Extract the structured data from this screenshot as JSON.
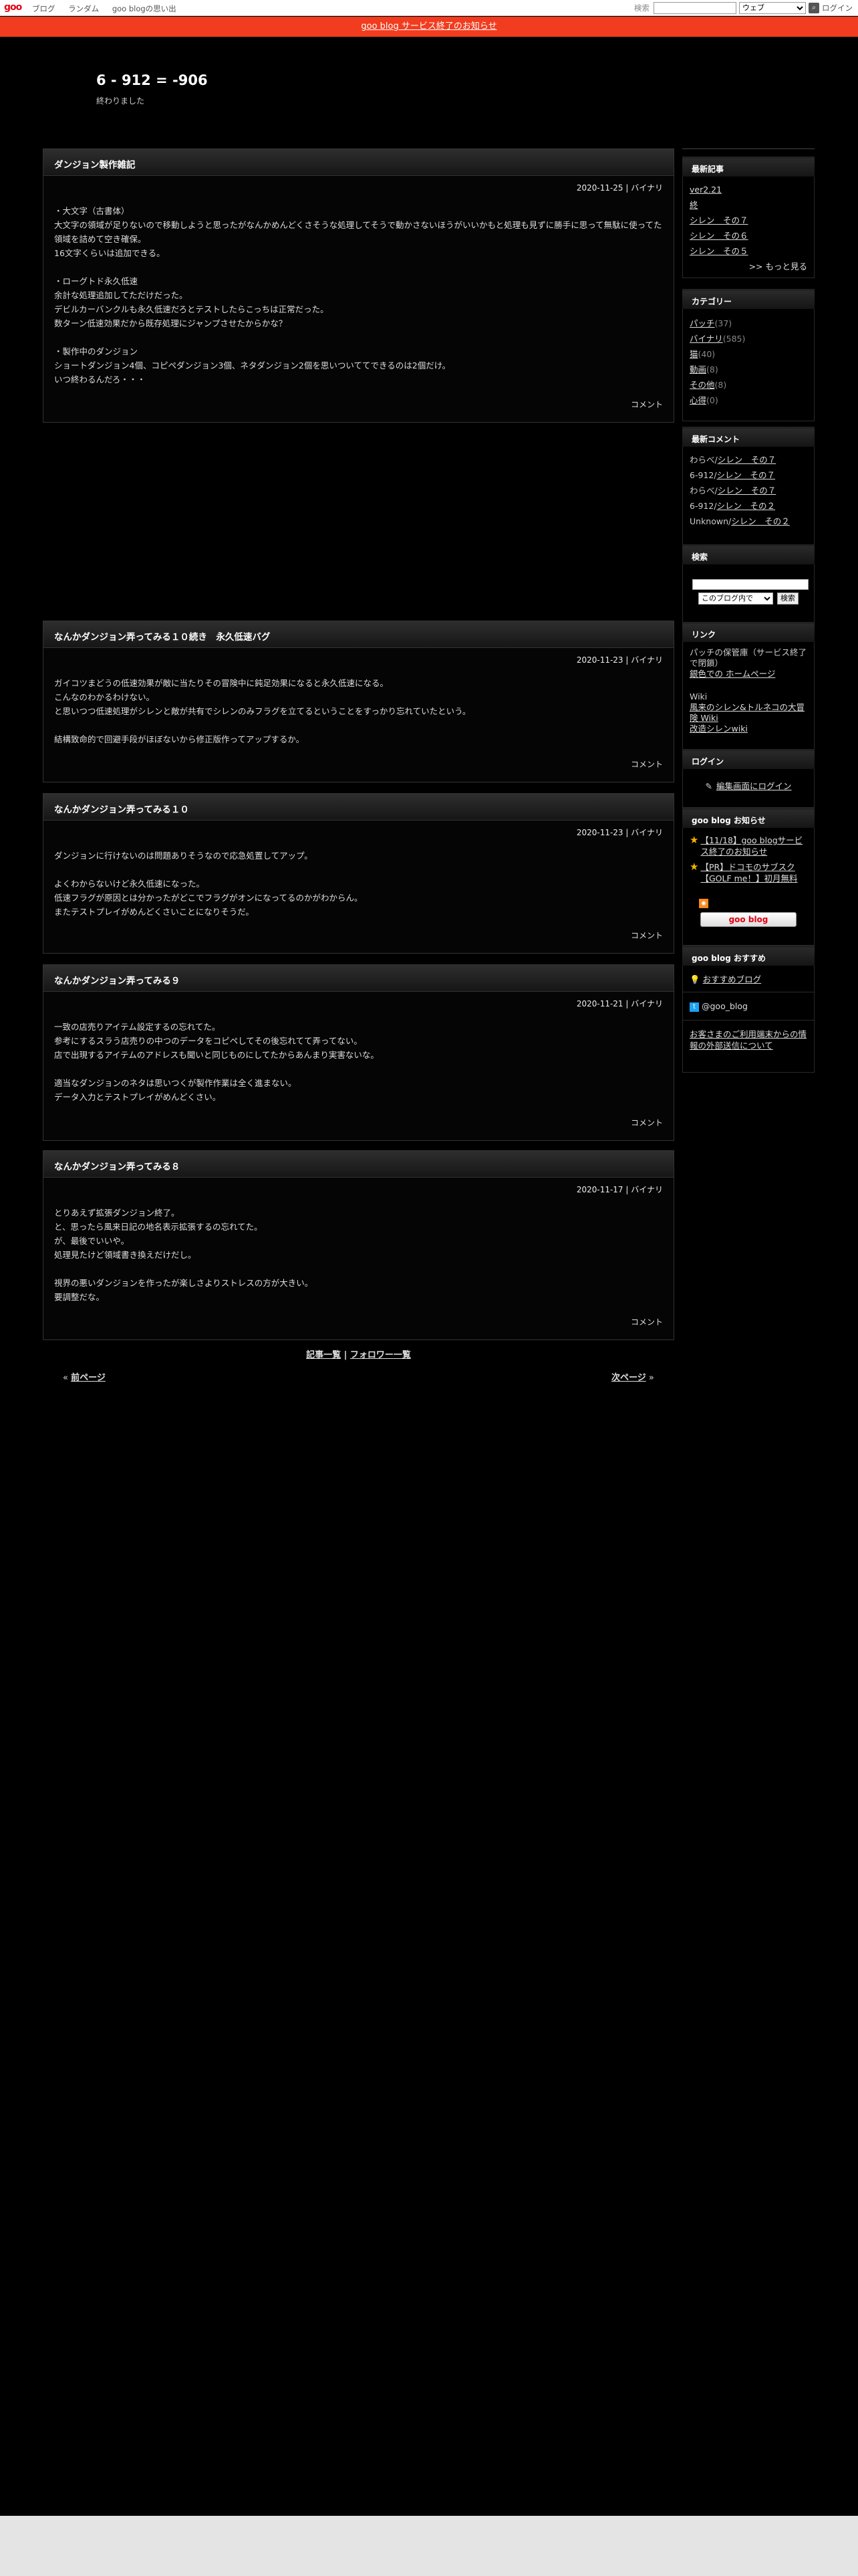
{
  "goo_bar": {
    "logo": "goo",
    "nav": [
      "ブログ",
      "ランダム",
      "goo blogの思い出"
    ],
    "search_label": "検索",
    "search_scope": "ウェブ",
    "login": "ログイン"
  },
  "notice": "goo blog サービス終了のお知らせ",
  "blog": {
    "title": "6 - 912 = -906",
    "description": "終わりました"
  },
  "posts": [
    {
      "title": "ダンジョン製作雑記",
      "meta": "2020-11-25 | バイナリ",
      "body": "・大文字（古書体）\n大文字の領域が足りないので移動しようと思ったがなんかめんどくさそうな処理してそうで動かさないほうがいいかもと処理も見ずに勝手に思って無駄に使ってた領域を詰めて空き確保。\n16文字くらいは追加できる。\n\n・ローグトド永久低速\n余計な処理追加してただけだった。\nデビルカーバンクルも永久低速だろとテストしたらこっちは正常だった。\n数ターン低速効果だから既存処理にジャンプさせたからかな？\n\n・製作中のダンジョン\nショートダンジョン4個、コピペダンジョン3個、ネタダンジョン2個を思いついててできるのは2個だけ。\nいつ終わるんだろ・・・",
      "comment": "コメント"
    },
    {
      "title": "なんかダンジョン弄ってみる１０続き　永久低速バグ",
      "meta": "2020-11-23 | バイナリ",
      "body": "ガイコツまどうの低速効果が敵に当たりその冒険中に鈍足効果になると永久低速になる。\nこんなのわかるわけない。\nと思いつつ低速処理がシレンと敵が共有でシレンのみフラグを立てるということをすっかり忘れていたという。\n\n結構致命的で回避手段がほぼないから修正版作ってアップするか。",
      "comment": "コメント"
    },
    {
      "title": "なんかダンジョン弄ってみる１０",
      "meta": "2020-11-23 | バイナリ",
      "body": "ダンジョンに行けないのは問題ありそうなので応急処置してアップ。\n\nよくわからないけど永久低速になった。\n低速フラグが原因とは分かったがどこでフラグがオンになってるのかがわからん。\nまたテストプレイがめんどくさいことになりそうだ。",
      "comment": "コメント"
    },
    {
      "title": "なんかダンジョン弄ってみる９",
      "meta": "2020-11-21 | バイナリ",
      "body": "一致の店売りアイテム設定するの忘れてた。\n参考にするスラう店売りの中つのデータをコピペしてその後忘れてて弄ってない。\n店で出現するアイテムのアドレスも聞いと同じものにしてたからあんまり実害ないな。\n\n適当なダンジョンのネタは思いつくが製作作業は全く進まない。\nデータ入力とテストプレイがめんどくさい。",
      "comment": "コメント"
    },
    {
      "title": "なんかダンジョン弄ってみる８",
      "meta": "2020-11-17 | バイナリ",
      "body": "とりあえず拡張ダンジョン終了。\nと、思ったら風来日記の地名表示拡張するの忘れてた。\nが、最後でいいや。\n処理見たけど領域書き換えだけだし。\n\n視界の悪いダンジョンを作ったが楽しさよりストレスの方が大きい。\n要調整だな。",
      "comment": "コメント"
    }
  ],
  "post_footer": {
    "list": "記事一覧",
    "sep": "|",
    "followers": "フォロワー一覧"
  },
  "pager": {
    "prev_arrow": "«",
    "prev": "前ページ",
    "next": "次ページ",
    "next_arrow": "»"
  },
  "sidebar": {
    "recent_title": "最新記事",
    "recent": [
      "ver2.21",
      "終",
      "シレン　その７",
      "シレン　その６",
      "シレン　その５"
    ],
    "recent_more": ">> もっと見る",
    "category_title": "カテゴリー",
    "categories": [
      {
        "name": "パッチ",
        "count": "(37)"
      },
      {
        "name": "バイナリ",
        "count": "(585)"
      },
      {
        "name": "猫",
        "count": "(40)"
      },
      {
        "name": "動画",
        "count": "(8)"
      },
      {
        "name": "その他",
        "count": "(8)"
      },
      {
        "name": "心得",
        "count": "(0)"
      }
    ],
    "comments_title": "最新コメント",
    "comments": [
      {
        "who": "わらべ/",
        "post": "シレン　その７"
      },
      {
        "who": "6-912/",
        "post": "シレン　その７"
      },
      {
        "who": "わらべ/",
        "post": "シレン　その７"
      },
      {
        "who": "6-912/",
        "post": "シレン　その２"
      },
      {
        "who": "Unknown/",
        "post": "シレン　その２"
      }
    ],
    "search_title": "検索",
    "search_scope": "このブログ内で",
    "search_button": "検索",
    "links_title": "リンク",
    "links_note": "パッチの保管庫（サービス終了で閉鎖）",
    "links_link1": "銀色での ホームページ",
    "links_wiki": "Wiki",
    "links_link2": "風来のシレン&トルネコの大冒険 Wiki",
    "links_link3": "改造シレンwiki",
    "login_title": "ログイン",
    "login_link": "編集画面にログイン",
    "news_title": "goo blog お知らせ",
    "news": [
      "【11/18】goo blogサービス終了のお知らせ",
      "【PR】ドコモのサブスク【GOLF me！】初月無料"
    ],
    "goo_badge": "goo blog",
    "recommend_title": "goo blog おすすめ",
    "recommend_link": "おすすめブログ",
    "twitter": "@goo_blog",
    "privacy": "お客さまのご利用端末からの情報の外部送信について"
  },
  "colors": {
    "background": "#000000",
    "notice_bar": "#f23c1f",
    "goo_red": "#e60012"
  }
}
